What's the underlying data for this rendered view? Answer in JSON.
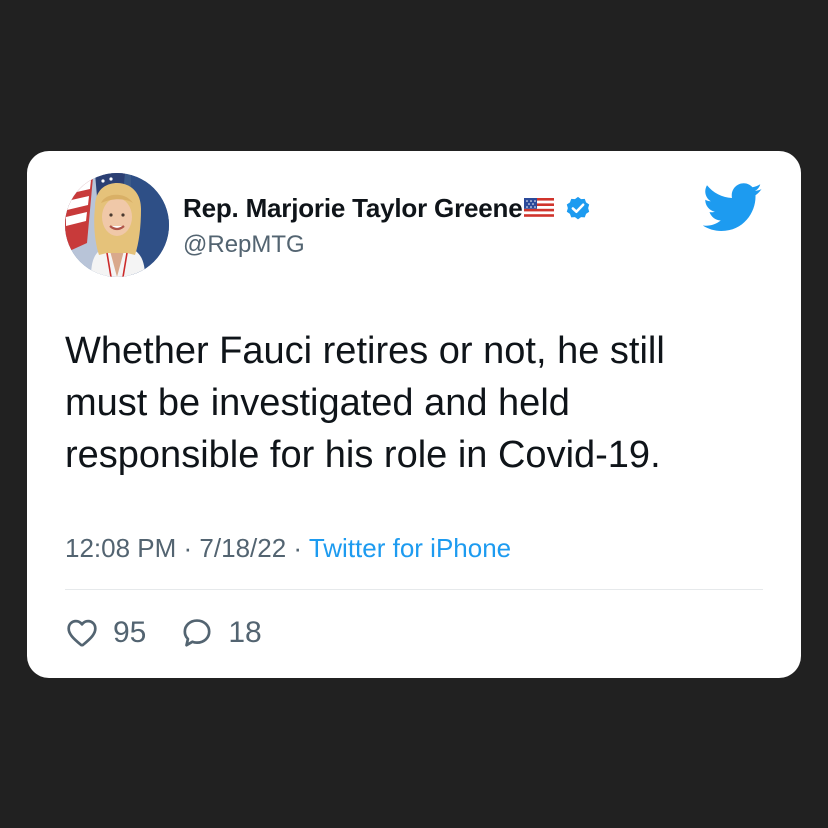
{
  "tweet": {
    "display_name": "Rep. Marjorie Taylor Greene",
    "handle": "@RepMTG",
    "text_lines": [
      "Whether Fauci retires or not, he still",
      "must be investigated and held",
      "responsible for his role in Covid-19."
    ],
    "time": "12:08 PM",
    "separator": "·",
    "date": "7/18/22",
    "source": "Twitter for iPhone",
    "likes": "95",
    "replies": "18"
  },
  "icons": {
    "avatar": "profile-photo",
    "flag": "us-flag-emoji",
    "verified": "verified-badge-icon",
    "logo": "twitter-bird-icon",
    "like": "heart-icon",
    "reply": "reply-bubble-icon"
  },
  "colors": {
    "background": "#212121",
    "card": "#ffffff",
    "text": "#0f1419",
    "secondary": "#536471",
    "accent": "#1d9bf0"
  }
}
